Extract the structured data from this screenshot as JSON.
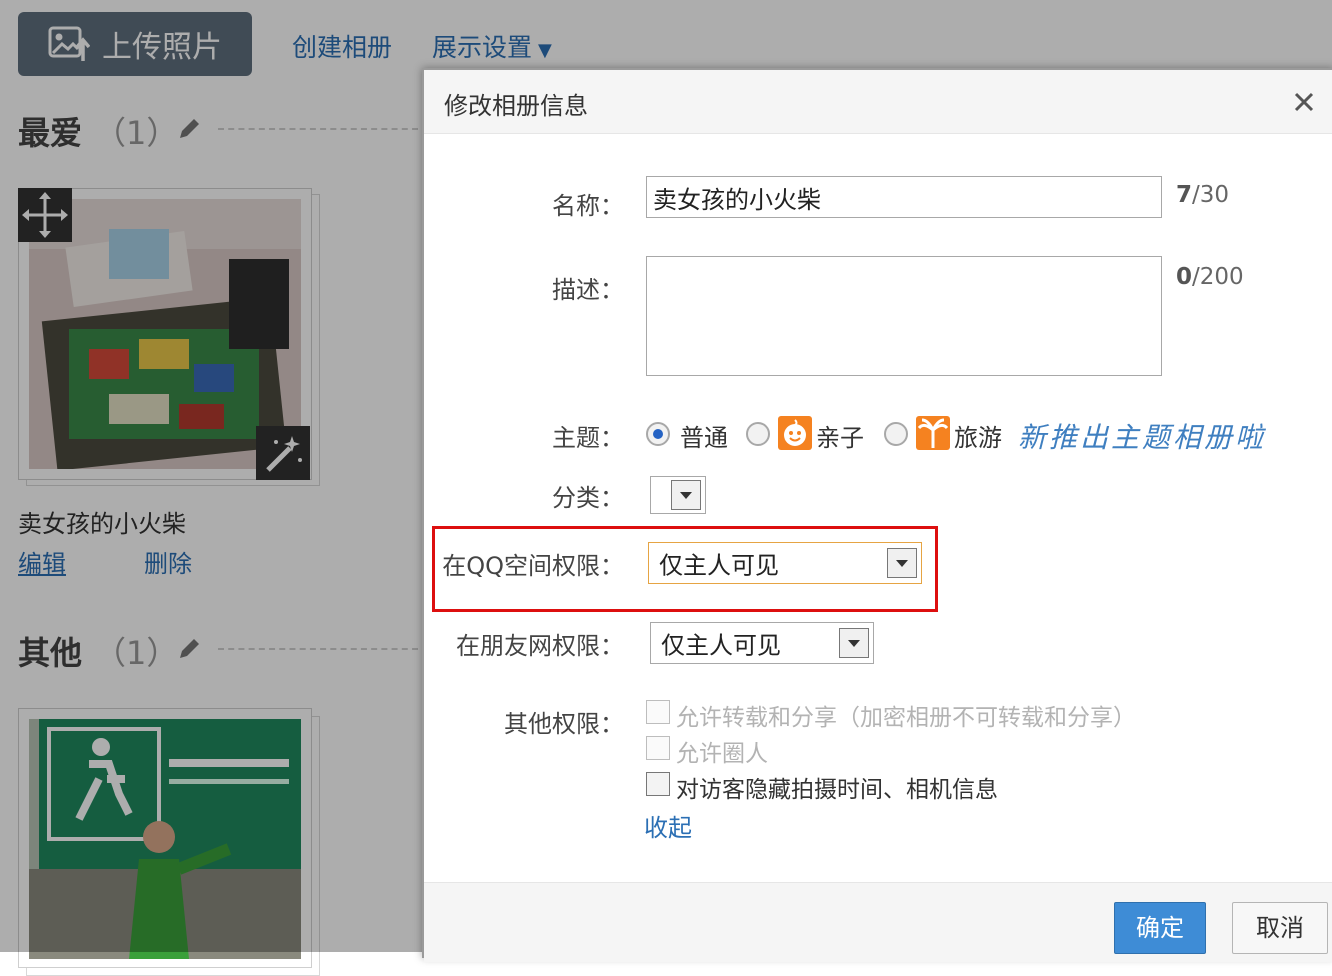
{
  "toolbar": {
    "upload_label": "上传照片",
    "create_album": "创建相册",
    "display_settings": "展示设置"
  },
  "sections": [
    {
      "title": "最爱",
      "count": "（1）"
    },
    {
      "title": "其他",
      "count": "（1）"
    }
  ],
  "album": {
    "name": "卖女孩的小火柴",
    "edit": "编辑",
    "delete": "删除"
  },
  "dialog": {
    "title": "修改相册信息",
    "name_label": "名称：",
    "name_value": "卖女孩的小火柴",
    "name_count": "7",
    "name_max": "/30",
    "desc_label": "描述：",
    "desc_count": "0",
    "desc_max": "/200",
    "theme_label": "主题：",
    "themes": [
      {
        "label": "普通",
        "checked": true
      },
      {
        "label": "亲子",
        "checked": false,
        "icon": "baby-face-icon"
      },
      {
        "label": "旅游",
        "checked": false,
        "icon": "palm-tree-icon"
      }
    ],
    "theme_promo": "新推出主题相册啦",
    "category_label": "分类：",
    "qzone_label": "在QQ空间权限：",
    "qzone_value": "仅主人可见",
    "pengyou_label": "在朋友网权限：",
    "pengyou_value": "仅主人可见",
    "other_label": "其他权限：",
    "options": [
      {
        "label": "允许转载和分享（加密相册不可转载和分享）",
        "enabled": false
      },
      {
        "label": "允许圈人",
        "enabled": false
      },
      {
        "label": "对访客隐藏拍摄时间、相机信息",
        "enabled": true
      }
    ],
    "collapse": "收起",
    "confirm": "确定",
    "cancel": "取消"
  },
  "colors": {
    "accent": "#3e8cd6",
    "link": "#2b6fb4",
    "highlight": "#dd0f0f",
    "theme_badge": "#f58220"
  }
}
